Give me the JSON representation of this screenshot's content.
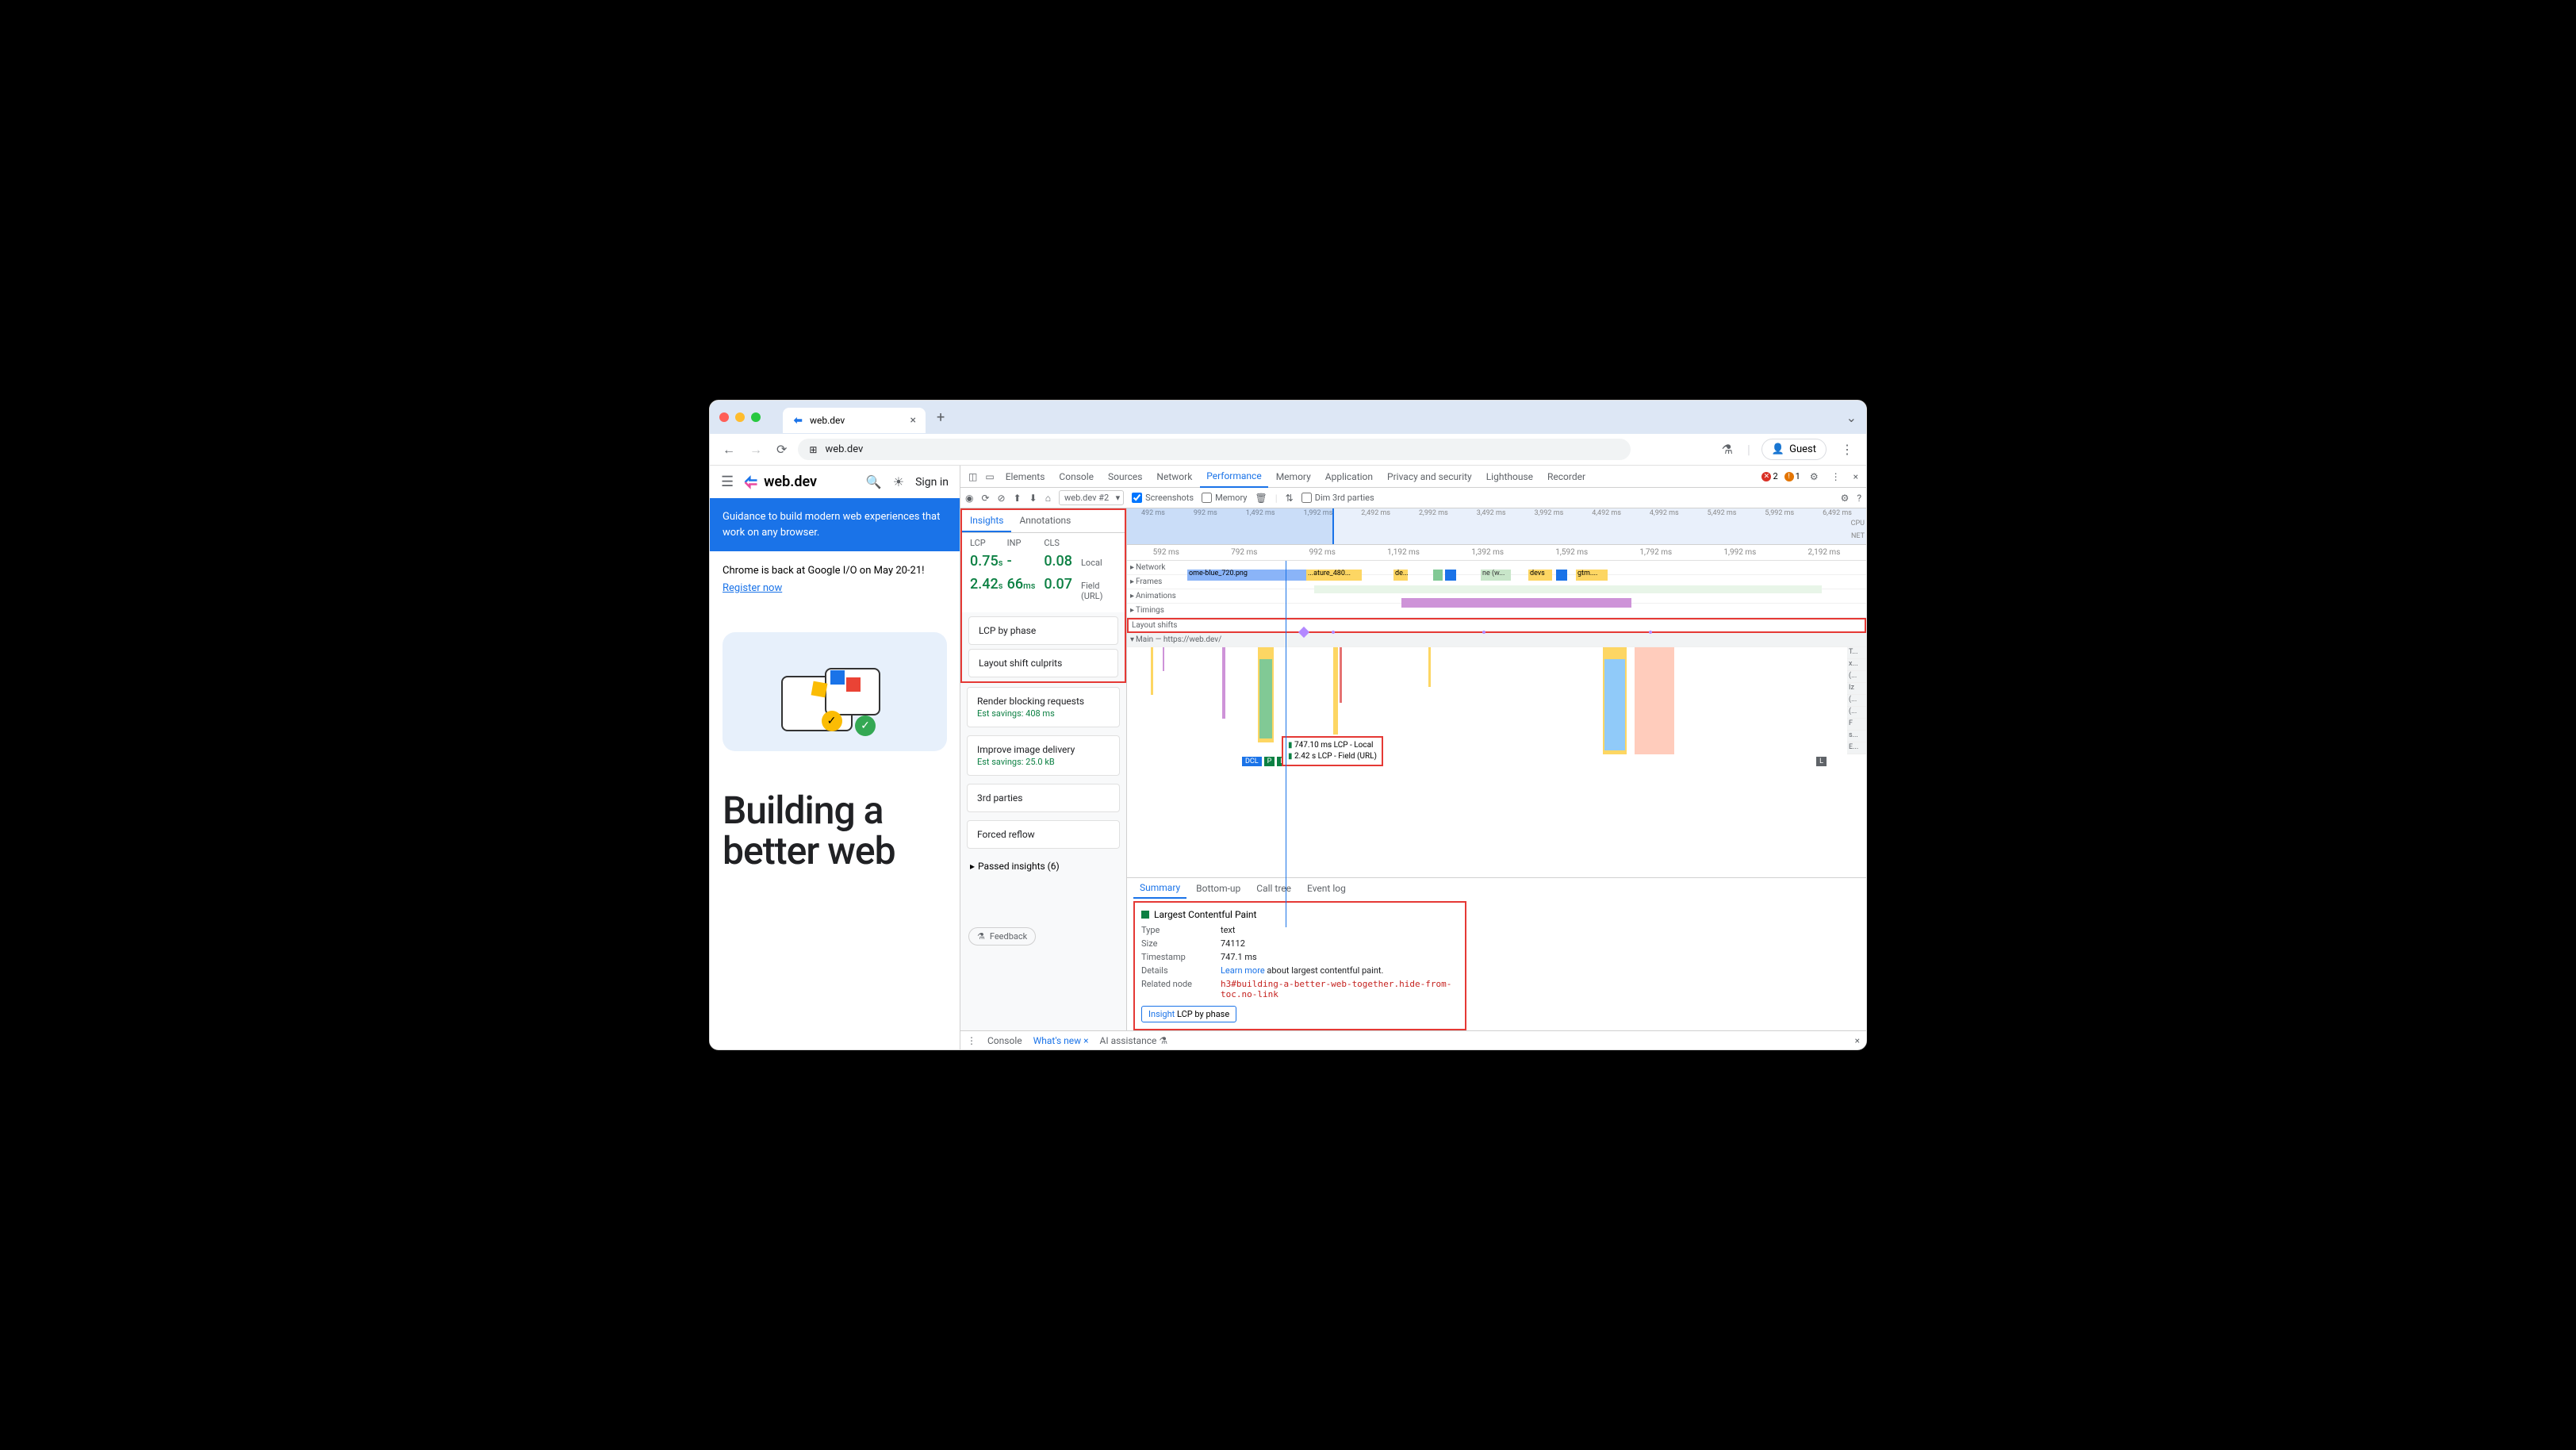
{
  "chrome": {
    "tab_title": "web.dev",
    "url": "web.dev",
    "guest": "Guest"
  },
  "site": {
    "logo": "web.dev",
    "signin": "Sign in",
    "banner_blue": "Guidance to build modern web experiences that work on any browser.",
    "banner_wht_1": "Chrome is back at Google I/O on May 20-21!",
    "banner_wht_link": "Register now",
    "hero": "Building a better web"
  },
  "devtools": {
    "tabs": [
      "Elements",
      "Console",
      "Sources",
      "Network",
      "Performance",
      "Memory",
      "Application",
      "Privacy and security",
      "Lighthouse",
      "Recorder"
    ],
    "active_tab": "Performance",
    "errors": "2",
    "warnings": "1",
    "toolbar": {
      "record_select": "web.dev #2",
      "screenshots": "Screenshots",
      "memory": "Memory",
      "dim": "Dim 3rd parties"
    },
    "insights": {
      "tabs": [
        "Insights",
        "Annotations"
      ],
      "metric_headers": [
        "LCP",
        "INP",
        "CLS"
      ],
      "local": {
        "lcp": "0.75",
        "lcp_u": "s",
        "inp": "-",
        "cls": "0.08",
        "label": "Local"
      },
      "field": {
        "lcp": "2.42",
        "lcp_u": "s",
        "inp": "66",
        "inp_u": "ms",
        "cls": "0.07",
        "label": "Field (URL)"
      },
      "items": [
        {
          "title": "LCP by phase"
        },
        {
          "title": "Layout shift culprits"
        },
        {
          "title": "Render blocking requests",
          "sub": "Est savings: 408 ms"
        },
        {
          "title": "Improve image delivery",
          "sub": "Est savings: 25.0 kB"
        },
        {
          "title": "3rd parties"
        },
        {
          "title": "Forced reflow"
        }
      ],
      "passed": "Passed insights (6)",
      "feedback": "Feedback"
    },
    "timeline": {
      "minimap_ticks": [
        "492 ms",
        "992 ms",
        "1,492 ms",
        "1,992 ms",
        "2,492 ms",
        "2,992 ms",
        "3,492 ms",
        "3,992 ms",
        "4,492 ms",
        "4,992 ms",
        "5,492 ms",
        "5,992 ms",
        "6,492 ms"
      ],
      "minimap_lbl_cpu": "CPU",
      "minimap_lbl_net": "NET",
      "ruler_ticks": [
        "592 ms",
        "792 ms",
        "992 ms",
        "1,192 ms",
        "1,392 ms",
        "1,592 ms",
        "1,792 ms",
        "1,992 ms",
        "2,192 ms"
      ],
      "tracks": {
        "network": "Network",
        "frames": "Frames",
        "animations": "Animations",
        "timings": "Timings",
        "layout_shifts": "Layout shifts",
        "main": "Main — https://web.dev/"
      },
      "net_blocks": [
        "ome-blue_720.png",
        "...ature_480...",
        "de...",
        "ne (w...",
        "devs",
        "gtm...."
      ],
      "markers": {
        "dcl": "DCL",
        "p": "P",
        "lcp": "LCP",
        "l": "L"
      },
      "lcp_callout_1": "747.10 ms LCP - Local",
      "lcp_callout_2": "2.42 s LCP - Field (URL)",
      "stack_lbls": [
        "T...",
        "x...",
        "(...",
        "Iz",
        "(...",
        "(...",
        "F",
        "s...",
        "E..."
      ]
    },
    "details": {
      "tabs": [
        "Summary",
        "Bottom-up",
        "Call tree",
        "Event log"
      ],
      "title": "Largest Contentful Paint",
      "type": "text",
      "size": "74112",
      "timestamp": "747.1 ms",
      "learn": "Learn more",
      "learn_after": " about largest contentful paint.",
      "node": "h3#building-a-better-web-together.hide-from-toc.no-link",
      "lbl_type": "Type",
      "lbl_size": "Size",
      "lbl_ts": "Timestamp",
      "lbl_details": "Details",
      "lbl_node": "Related node",
      "insight_k": "Insight",
      "insight_v": "LCP by phase"
    },
    "drawer": {
      "console": "Console",
      "whatsnew": "What's new",
      "ai": "AI assistance"
    }
  }
}
